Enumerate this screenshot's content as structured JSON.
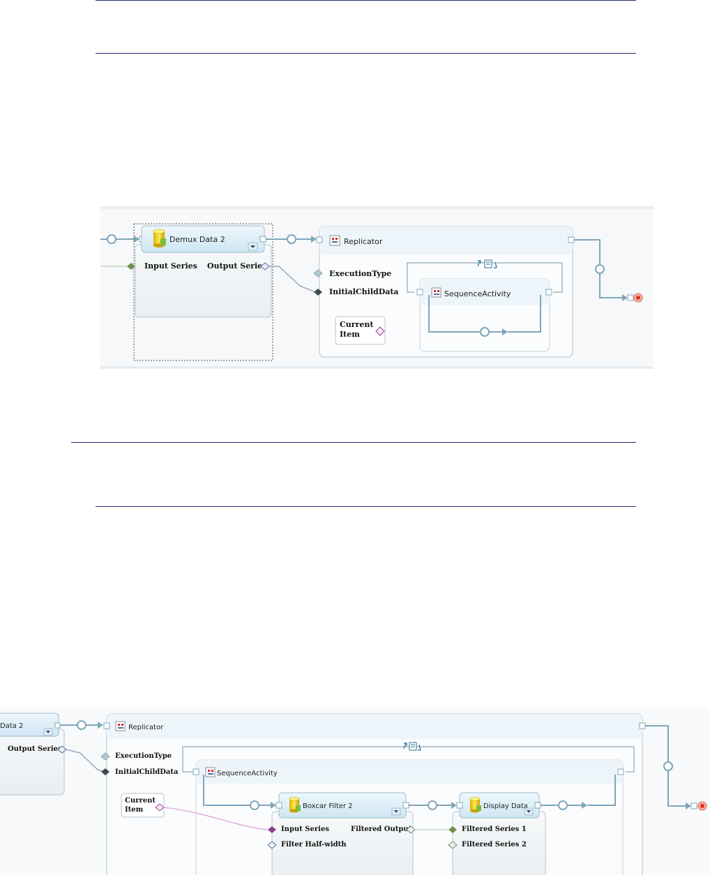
{
  "diagram1": {
    "demux": {
      "title": "Demux Data 2",
      "input": "Input Series",
      "output": "Output Series"
    },
    "replicator": {
      "title": "Replicator",
      "exec": "ExecutionType",
      "initial": "InitialChildData",
      "current_line1": "Current",
      "current_line2": "Item"
    },
    "sequence": {
      "title": "SequenceActivity"
    }
  },
  "diagram2": {
    "demux": {
      "title": "Data 2",
      "output": "Output Series"
    },
    "replicator": {
      "title": "Replicator",
      "exec": "ExecutionType",
      "initial": "InitialChildData",
      "current_line1": "Current",
      "current_line2": "Item"
    },
    "sequence": {
      "title": "SequenceActivity"
    },
    "boxcar": {
      "title": "Boxcar Filter 2",
      "input": "Input Series",
      "halfwidth": "Filter Half-width",
      "output": "Filtered Output"
    },
    "display": {
      "title": "Display Data",
      "series1": "Filtered Series 1",
      "series2": "Filtered Series 2"
    }
  }
}
